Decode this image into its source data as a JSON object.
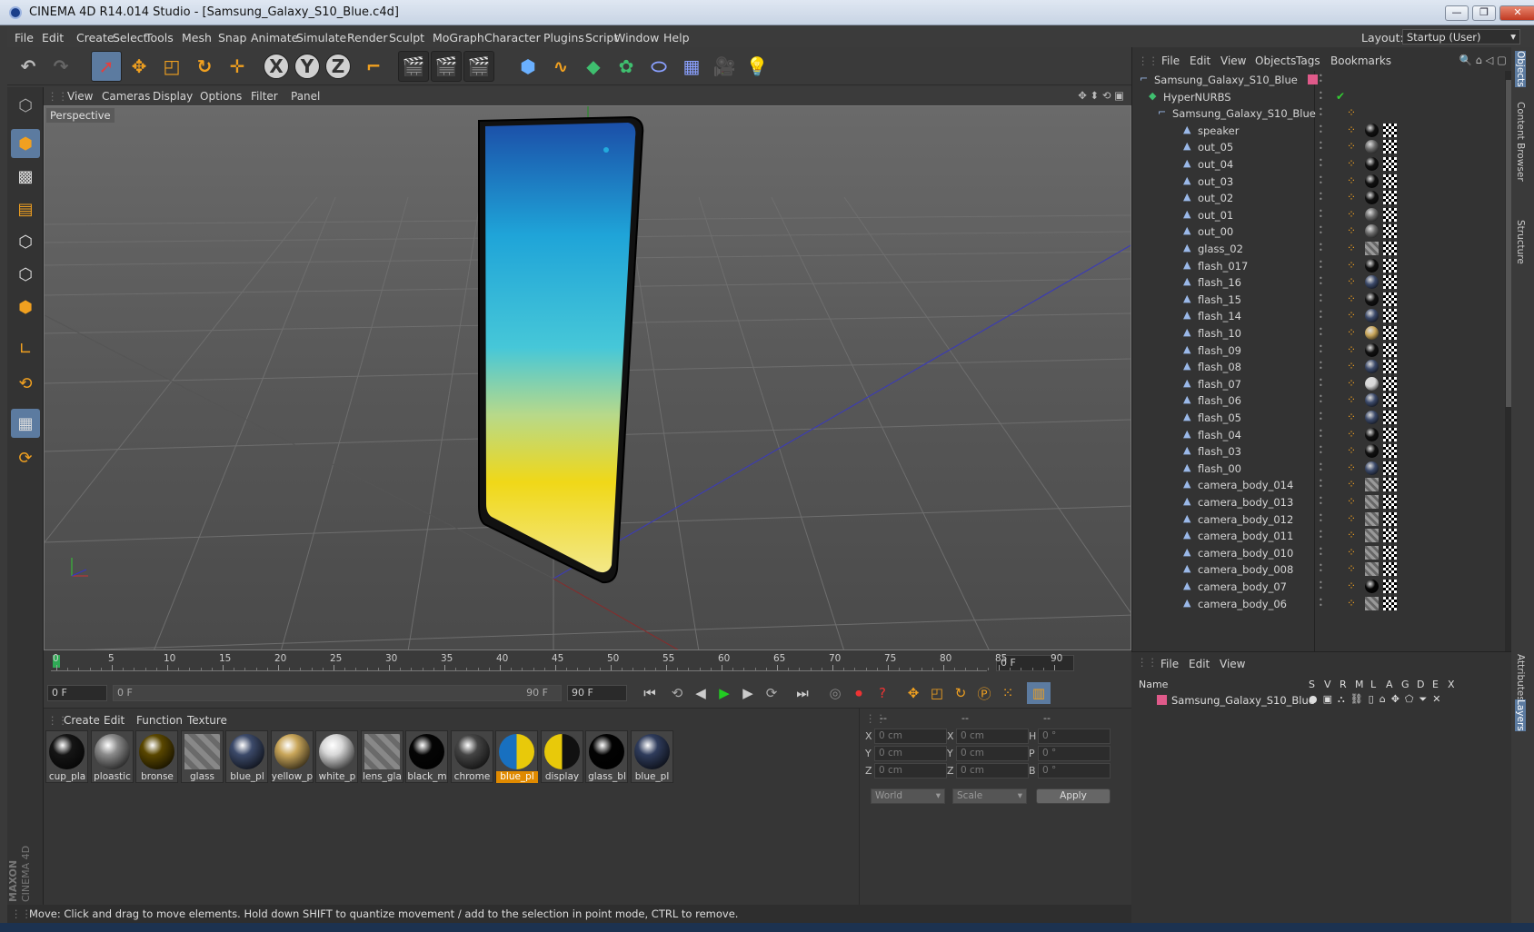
{
  "window": {
    "title": "CINEMA 4D R14.014 Studio - [Samsung_Galaxy_S10_Blue.c4d]"
  },
  "menu": [
    "File",
    "Edit",
    "Create",
    "Select",
    "Tools",
    "Mesh",
    "Snap",
    "Animate",
    "Simulate",
    "Render",
    "Sculpt",
    "MoGraph",
    "Character",
    "Plugins",
    "Script",
    "Window",
    "Help"
  ],
  "layout": {
    "label": "Layout:",
    "value": "Startup (User)"
  },
  "viewport": {
    "menu": [
      "View",
      "Cameras",
      "Display",
      "Options",
      "Filter",
      "Panel"
    ],
    "label": "Perspective"
  },
  "timeline": {
    "ticks": [
      "0",
      "5",
      "10",
      "15",
      "20",
      "25",
      "30",
      "35",
      "40",
      "45",
      "50",
      "55",
      "60",
      "65",
      "70",
      "75",
      "80",
      "85",
      "90"
    ],
    "current_frame": "0 F",
    "start_frame": "0 F",
    "range_start": "0 F",
    "range_end": "90 F",
    "end_frame": "90 F"
  },
  "materials": {
    "menu": [
      "Create",
      "Edit",
      "Function",
      "Texture"
    ],
    "items": [
      {
        "name": "cup_pla",
        "color": "#151515",
        "style": "dark"
      },
      {
        "name": "ploastic",
        "color": "#8a8a8a",
        "style": "gray"
      },
      {
        "name": "bronse",
        "color": "#5a4700",
        "style": "gold"
      },
      {
        "name": "glass",
        "color": "#777777",
        "style": "checker"
      },
      {
        "name": "blue_pl",
        "color": "#3c4a6a",
        "style": "blue"
      },
      {
        "name": "yellow_p",
        "color": "#c9a65a",
        "style": "yellow"
      },
      {
        "name": "white_p",
        "color": "#d8d8d8",
        "style": "white"
      },
      {
        "name": "lens_gla",
        "color": "#777777",
        "style": "checker"
      },
      {
        "name": "black_m",
        "color": "#050505",
        "style": "black"
      },
      {
        "name": "chrome",
        "color": "#444444",
        "style": "chrome"
      },
      {
        "name": "blue_pl",
        "color": "#2f8fd8",
        "style": "screen"
      },
      {
        "name": "display",
        "color": "#e8c90a",
        "style": "display"
      },
      {
        "name": "glass_bl",
        "color": "#020202",
        "style": "black"
      },
      {
        "name": "blue_pl",
        "color": "#2f3c5c",
        "style": "blue"
      }
    ]
  },
  "coords": {
    "headers": [
      "--",
      "--",
      "--"
    ],
    "rows": [
      {
        "a": "X",
        "pos": "0 cm",
        "b": "X",
        "size": "0 cm",
        "c": "H",
        "rot": "0 °"
      },
      {
        "a": "Y",
        "pos": "0 cm",
        "b": "Y",
        "size": "0 cm",
        "c": "P",
        "rot": "0 °"
      },
      {
        "a": "Z",
        "pos": "0 cm",
        "b": "Z",
        "size": "0 cm",
        "c": "B",
        "rot": "0 °"
      }
    ],
    "mode1": "World",
    "mode2": "Scale",
    "apply": "Apply"
  },
  "status": "Move: Click and drag to move elements. Hold down SHIFT to quantize movement / add to the selection in point mode, CTRL to remove.",
  "objects": {
    "menu": [
      "File",
      "Edit",
      "View",
      "Objects",
      "Tags",
      "Bookmarks"
    ],
    "items": [
      {
        "name": "Samsung_Galaxy_S10_Blue",
        "level": 0,
        "mat": "none"
      },
      {
        "name": "HyperNURBS",
        "level": 1,
        "mat": "none"
      },
      {
        "name": "Samsung_Galaxy_S10_Blue",
        "level": 2,
        "mat": "none"
      },
      {
        "name": "speaker",
        "level": 3,
        "mat": "#111"
      },
      {
        "name": "out_05",
        "level": 3,
        "mat": "#6a6a6a"
      },
      {
        "name": "out_04",
        "level": 3,
        "mat": "#111"
      },
      {
        "name": "out_03",
        "level": 3,
        "mat": "#111"
      },
      {
        "name": "out_02",
        "level": 3,
        "mat": "#111"
      },
      {
        "name": "out_01",
        "level": 3,
        "mat": "#6a6a6a"
      },
      {
        "name": "out_00",
        "level": 3,
        "mat": "#6a6a6a"
      },
      {
        "name": "glass_02",
        "level": 3,
        "mat": "checker"
      },
      {
        "name": "flash_017",
        "level": 3,
        "mat": "#111"
      },
      {
        "name": "flash_16",
        "level": 3,
        "mat": "#3c4a6a"
      },
      {
        "name": "flash_15",
        "level": 3,
        "mat": "#111"
      },
      {
        "name": "flash_14",
        "level": 3,
        "mat": "#3c4a6a"
      },
      {
        "name": "flash_10",
        "level": 3,
        "mat": "#c9a65a"
      },
      {
        "name": "flash_09",
        "level": 3,
        "mat": "#111"
      },
      {
        "name": "flash_08",
        "level": 3,
        "mat": "#3c4a6a"
      },
      {
        "name": "flash_07",
        "level": 3,
        "mat": "#d8d8d8"
      },
      {
        "name": "flash_06",
        "level": 3,
        "mat": "#3c4a6a"
      },
      {
        "name": "flash_05",
        "level": 3,
        "mat": "#3c4a6a"
      },
      {
        "name": "flash_04",
        "level": 3,
        "mat": "#111"
      },
      {
        "name": "flash_03",
        "level": 3,
        "mat": "#111"
      },
      {
        "name": "flash_00",
        "level": 3,
        "mat": "#3c4a6a"
      },
      {
        "name": "camera_body_014",
        "level": 3,
        "mat": "checker"
      },
      {
        "name": "camera_body_013",
        "level": 3,
        "mat": "checker"
      },
      {
        "name": "camera_body_012",
        "level": 3,
        "mat": "checker"
      },
      {
        "name": "camera_body_011",
        "level": 3,
        "mat": "checker"
      },
      {
        "name": "camera_body_010",
        "level": 3,
        "mat": "checker"
      },
      {
        "name": "camera_body_008",
        "level": 3,
        "mat": "checker"
      },
      {
        "name": "camera_body_07",
        "level": 3,
        "mat": "#050505"
      },
      {
        "name": "camera_body_06",
        "level": 3,
        "mat": "checker"
      }
    ]
  },
  "layers": {
    "menu": [
      "File",
      "Edit",
      "View"
    ],
    "header_name": "Name",
    "columns": [
      "S",
      "V",
      "R",
      "M",
      "L",
      "A",
      "G",
      "D",
      "E",
      "X"
    ],
    "rows": [
      {
        "name": "Samsung_Galaxy_S10_Blue",
        "color": "#e05a8a"
      }
    ]
  },
  "right_tabs": [
    "Objects",
    "Content Browser",
    "Structure",
    "Attributes",
    "Layers"
  ],
  "branding": {
    "maxon": "MAXON",
    "product": "CINEMA 4D"
  },
  "accent": "#e08a00"
}
